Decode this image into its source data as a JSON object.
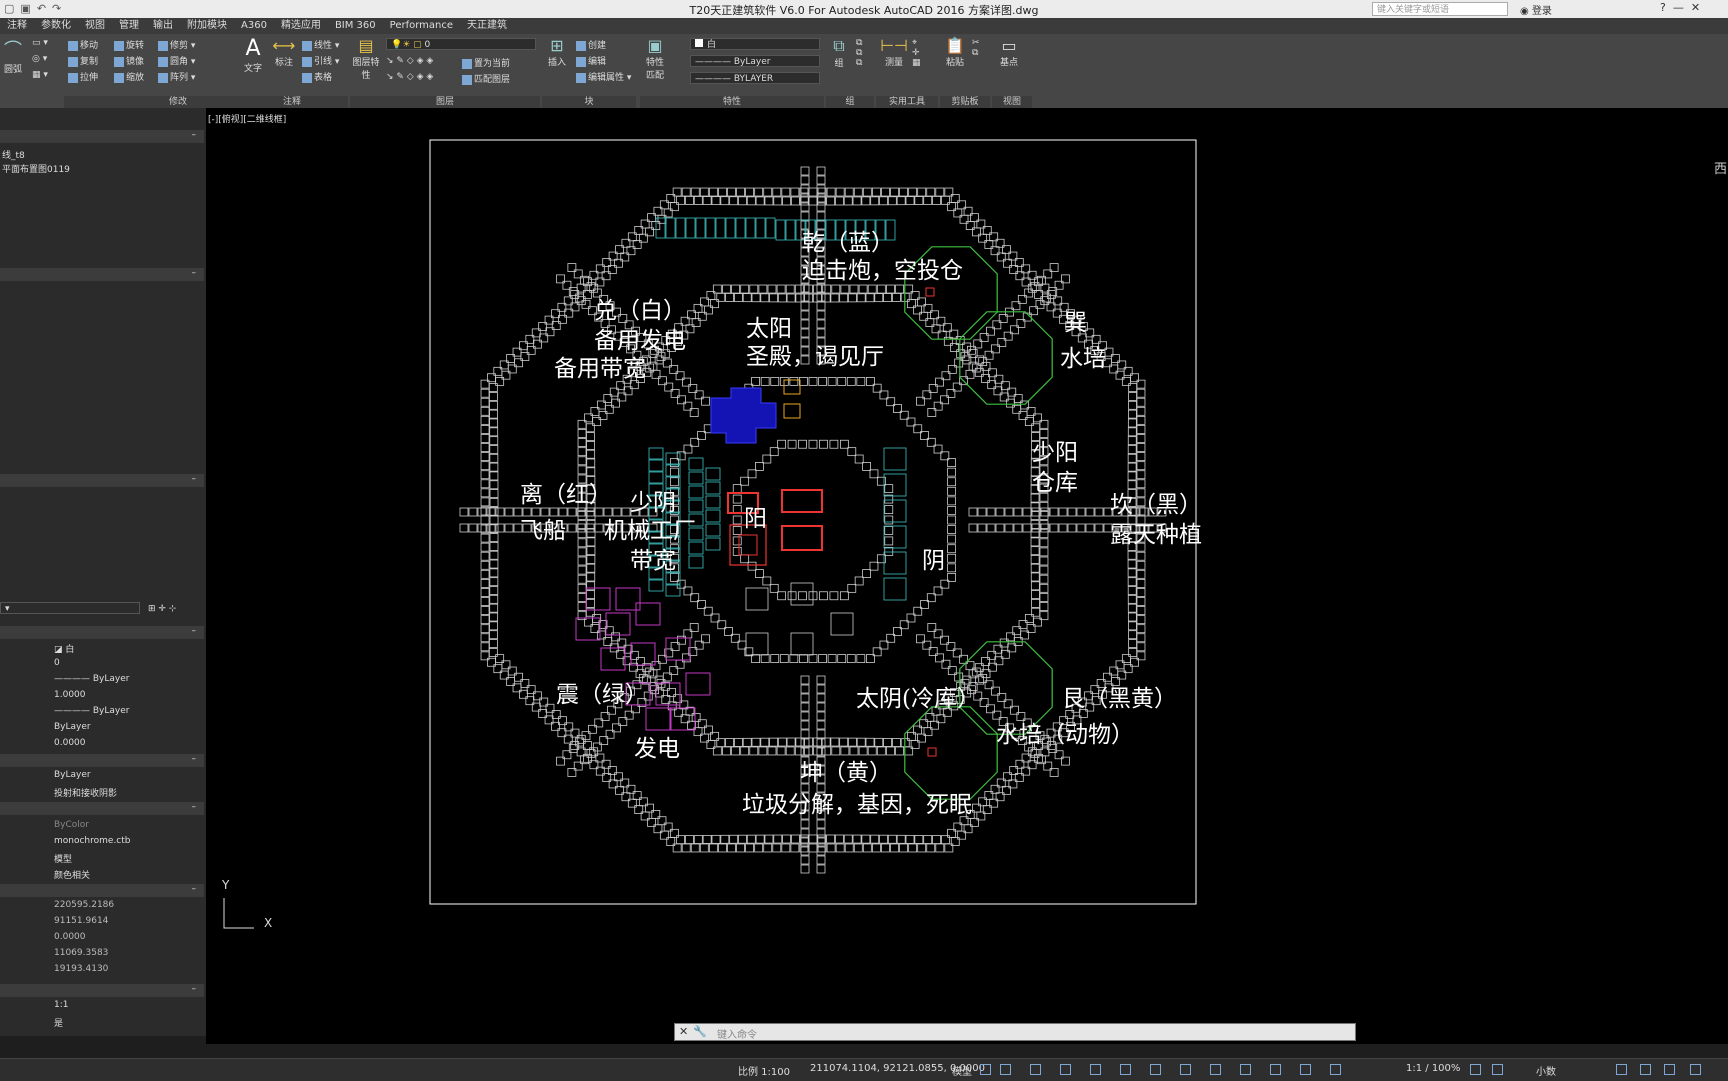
{
  "titlebar": {
    "title": "T20天正建筑软件 V6.0 For Autodesk AutoCAD 2016    方案详图.dwg",
    "search_placeholder": "键入关键字或短语",
    "login_label": "登录",
    "qat_icons": [
      "new-icon",
      "save-icon",
      "undo-icon",
      "redo-icon"
    ]
  },
  "tabs": [
    "注释",
    "参数化",
    "视图",
    "管理",
    "输出",
    "附加模块",
    "A360",
    "精选应用",
    "BIM 360",
    "Performance",
    "天正建筑"
  ],
  "ribbon": {
    "arc_label": "圆弧",
    "modify": {
      "label": "修改",
      "items": [
        "移动",
        "旋转",
        "修剪",
        "复制",
        "镜像",
        "圆角",
        "拉伸",
        "缩放",
        "阵列"
      ]
    },
    "annotate": {
      "label": "注释",
      "text": "文字",
      "dim": "标注",
      "items": [
        "线性",
        "引线",
        "表格"
      ]
    },
    "layers": {
      "label": "图层",
      "props": "图层特性",
      "current": "0",
      "items": [
        "置为当前",
        "匹配图层"
      ]
    },
    "block": {
      "label": "块",
      "insert": "插入",
      "items": [
        "创建",
        "编辑",
        "编辑属性"
      ]
    },
    "properties": {
      "label": "特性",
      "match": "特性匹配",
      "color": "白",
      "linetype": "ByLayer",
      "lineweight": "BYLAYER"
    },
    "groups": {
      "label": "组",
      "group": "组"
    },
    "utilities": {
      "label": "实用工具",
      "measure": "测量"
    },
    "clipboard": {
      "label": "剪贴板",
      "paste": "粘贴"
    },
    "view": {
      "label": "视图",
      "base": "基点"
    }
  },
  "palette": {
    "file_lines": [
      "线_t8",
      "平面布置图0119"
    ],
    "props": [
      "白",
      "0",
      "ByLayer",
      "1.0000",
      "ByLayer",
      "ByLayer",
      "0.0000"
    ],
    "props2": [
      "ByLayer",
      "投射和接收阴影"
    ],
    "plot": [
      "ByColor",
      "monochrome.ctb",
      "模型",
      "颜色相关"
    ],
    "geom": [
      "220595.2186",
      "91151.9614",
      "0.0000",
      "11069.3583",
      "19193.4130"
    ],
    "misc": [
      "1:1",
      "是"
    ]
  },
  "drawing": {
    "view_label": "[-][俯视][二维线框]",
    "compass": "西",
    "ucs_x": "X",
    "ucs_y": "Y",
    "labels": {
      "qian": "乾（蓝）",
      "qian_sub": "迫击炮，空投仓",
      "dui": "兑（白）",
      "dui_sub1": "备用发电",
      "dui_sub2": "备用带宽",
      "taiyang": "太阳",
      "taiyang_sub": "圣殿，谒见厅",
      "xun": "巽",
      "xun_sub": "水培",
      "shaoyang": "少阳",
      "shaoyang_sub": "仓库",
      "li": "离（红）",
      "li_sub": "飞船",
      "shaoyin": "少阴",
      "shaoyin_sub1": "机械工厂",
      "shaoyin_sub2": "带宽",
      "yang": "阳",
      "yin": "阴",
      "kan": "坎（黑）",
      "kan_sub": "露天种植",
      "zhen": "震（绿）",
      "zhen_sub": "发电",
      "taiyin": "太阴(冷库）",
      "gen": "艮（黑黄）",
      "gen_sub": "水培（动物）",
      "kun": "坤（黄）",
      "kun_sub": "垃圾分解，基因，死眠"
    }
  },
  "command": {
    "placeholder": "键入命令"
  },
  "statusbar": {
    "scale": "比例 1:100",
    "coords": "211074.1104, 92121.0855, 0.0000",
    "mode": "模型",
    "annot_scale": "1:1 / 100%",
    "units": "小数"
  }
}
